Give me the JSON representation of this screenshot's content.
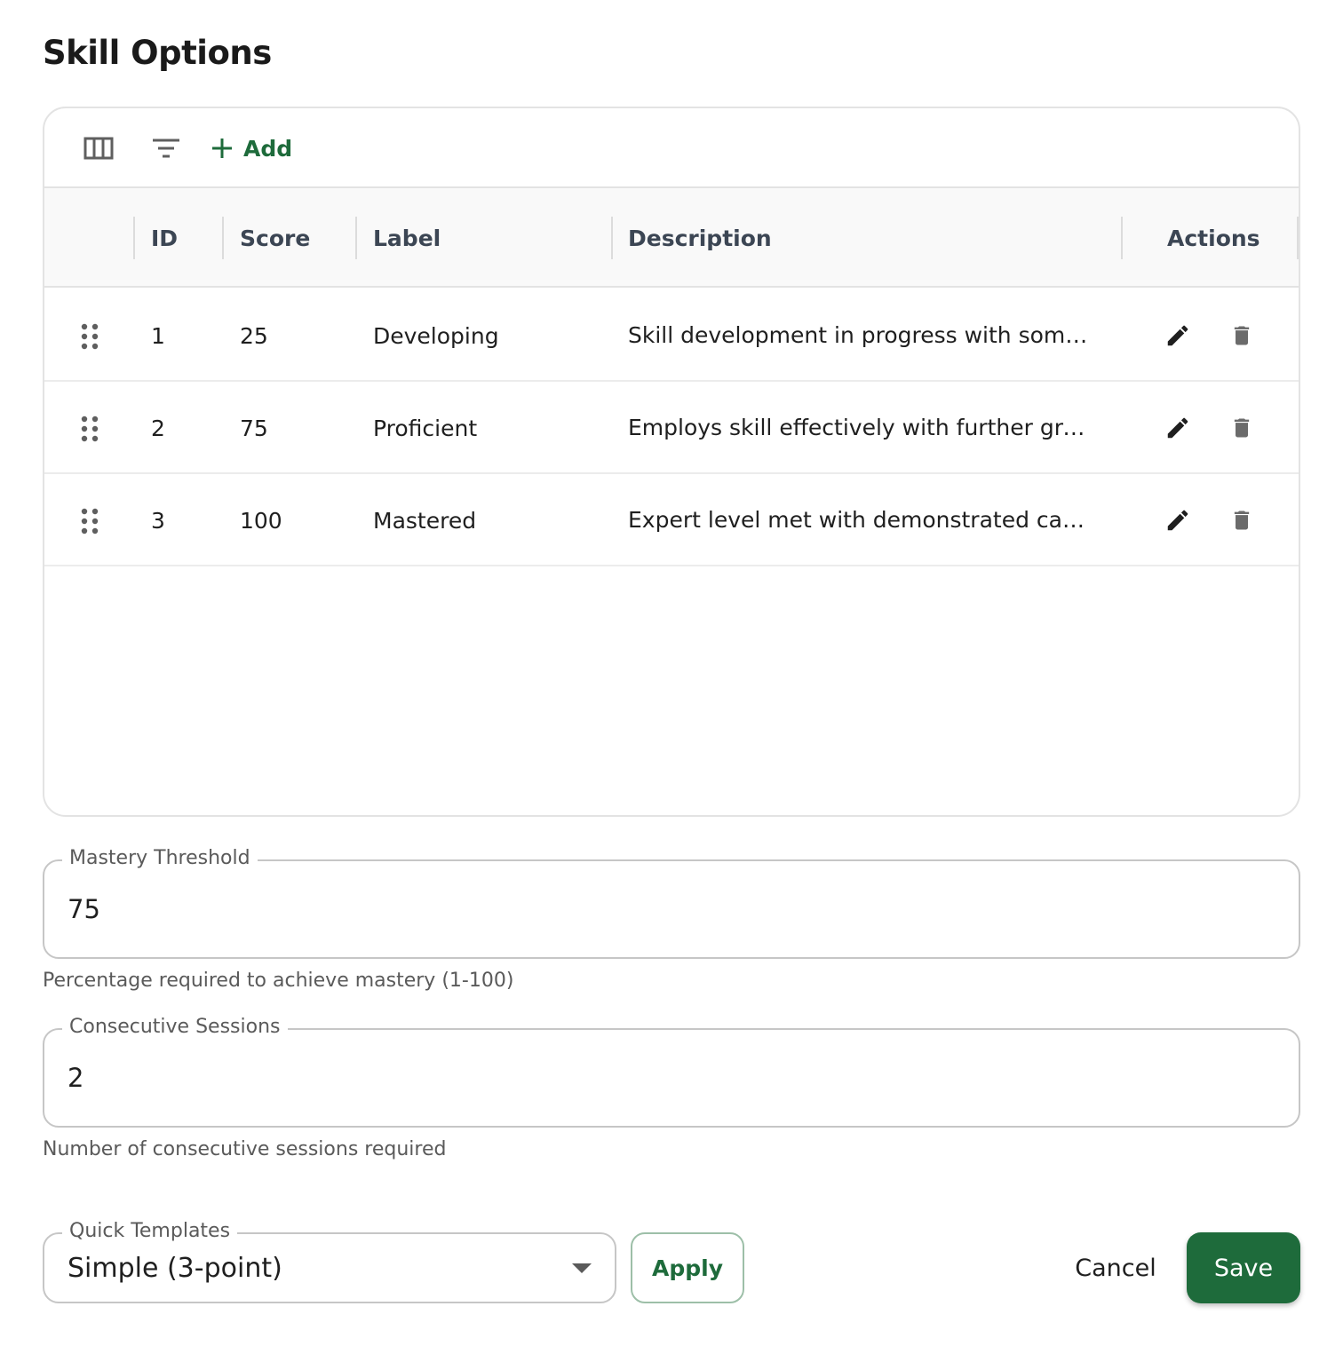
{
  "dialog": {
    "title": "Skill Options"
  },
  "toolbar": {
    "columns_icon": "view-column-icon",
    "filter_icon": "filter-list-icon",
    "add_icon": "plus-icon",
    "add_label": "Add"
  },
  "table": {
    "columns": [
      "ID",
      "Score",
      "Label",
      "Description",
      "Actions"
    ],
    "rows": [
      {
        "id": "1",
        "score": "25",
        "label": "Developing",
        "description": "Skill development in progress with some ..."
      },
      {
        "id": "2",
        "score": "75",
        "label": "Proficient",
        "description": "Employs skill effectively with further gro..."
      },
      {
        "id": "3",
        "score": "100",
        "label": "Mastered",
        "description": "Expert level met with demonstrated cap..."
      }
    ],
    "row_icons": {
      "drag": "drag-indicator-icon",
      "edit": "pencil-icon",
      "delete": "trash-icon"
    }
  },
  "mastery": {
    "label": "Mastery Threshold",
    "value": "75",
    "helper": "Percentage required to achieve mastery (1-100)"
  },
  "sessions": {
    "label": "Consecutive Sessions",
    "value": "2",
    "helper": "Number of consecutive sessions required"
  },
  "templates": {
    "label": "Quick Templates",
    "selected": "Simple (3-point)"
  },
  "buttons": {
    "apply": "Apply",
    "cancel": "Cancel",
    "save": "Save"
  },
  "colors": {
    "accent": "#1e6b3b",
    "border": "#e3e3e3",
    "header_bg": "#f9f9f9"
  }
}
